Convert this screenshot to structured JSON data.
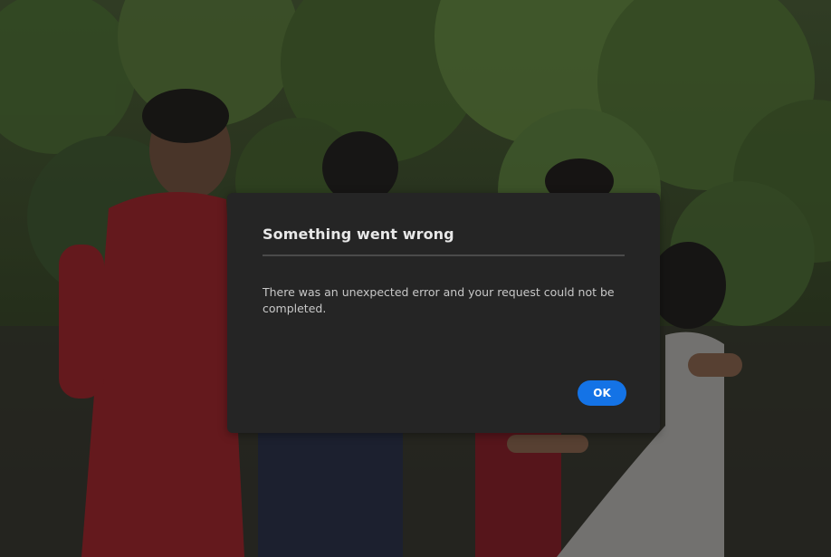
{
  "dialog": {
    "title": "Something went wrong",
    "message": "There was an unexpected error and your request could not be completed.",
    "ok_label": "OK"
  },
  "colors": {
    "dialog_background": "#252525",
    "accent_button": "#1473e6",
    "title_text": "#e8e8e8",
    "body_text": "#c8c8c8"
  }
}
